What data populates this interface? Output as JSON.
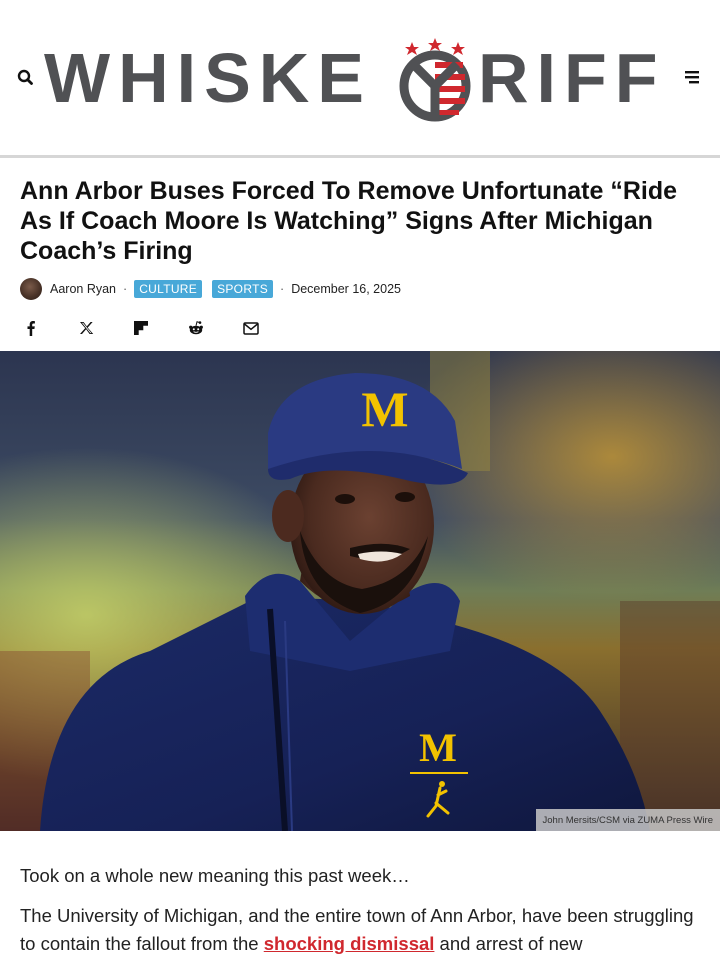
{
  "site": {
    "logo_text_left": "WHISKE",
    "logo_text_right": "RIFF",
    "logo_colors": {
      "text": "#505154",
      "stars": "#d0282e",
      "stripes_red": "#d0282e",
      "stripes_blue": "#27416e"
    }
  },
  "header": {
    "search_icon": "search-icon",
    "menu_icon": "hamburger-menu-icon"
  },
  "article": {
    "title": "Ann Arbor Buses Forced To Remove Unfortunate “Ride As If Coach Moore Is Watching” Signs After Michigan Coach’s Firing",
    "author": "Aaron Ryan",
    "meta_separator": "·",
    "categories": [
      "CULTURE",
      "SPORTS"
    ],
    "date": "December 16, 2025",
    "category_color": "#48a8d8",
    "link_color": "#d0282e"
  },
  "share": {
    "icons": [
      "facebook-icon",
      "x-icon",
      "flipboard-icon",
      "reddit-icon",
      "email-icon"
    ]
  },
  "hero": {
    "credit": "John Mersits/CSM via ZUMA Press Wire",
    "cap_logo": "M",
    "shirt_logo": "M"
  },
  "body": {
    "p1": "Took on a whole new meaning this past week…",
    "p2_before": "The University of Michigan, and the entire town of Ann Arbor, have been struggling to contain the fallout from the ",
    "p2_link": "shocking dismissal",
    "p2_after": " and arrest of new"
  }
}
